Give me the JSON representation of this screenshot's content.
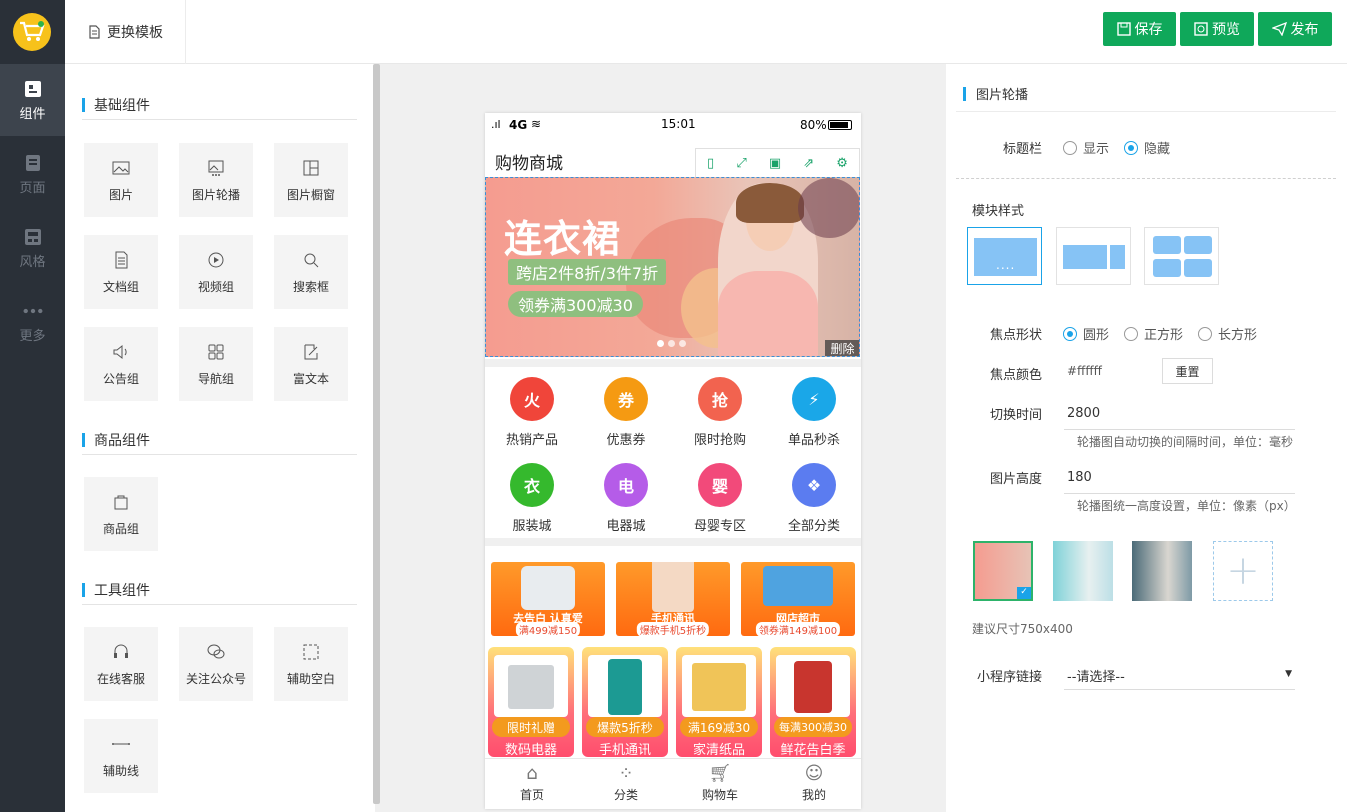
{
  "rail": {
    "items": [
      {
        "label": "组件",
        "icon": "component-icon"
      },
      {
        "label": "页面",
        "icon": "page-icon"
      },
      {
        "label": "风格",
        "icon": "style-icon"
      },
      {
        "label": "更多",
        "icon": "more-icon"
      }
    ]
  },
  "topbar": {
    "template_label": "更换模板",
    "save_label": "保存",
    "preview_label": "预览",
    "publish_label": "发布"
  },
  "left": {
    "sections": [
      {
        "title": "基础组件",
        "tiles": [
          "图片",
          "图片轮播",
          "图片橱窗",
          "文档组",
          "视频组",
          "搜索框",
          "公告组",
          "导航组",
          "富文本"
        ]
      },
      {
        "title": "商品组件",
        "tiles": [
          "商品组"
        ]
      },
      {
        "title": "工具组件",
        "tiles": [
          "在线客服",
          "关注公众号",
          "辅助空白",
          "辅助线"
        ]
      }
    ]
  },
  "phone": {
    "signal": "4G",
    "time": "15:01",
    "battery": "80%",
    "title": "购物商城",
    "banner": {
      "headline": "连衣裙",
      "line1": "跨店2件8折/3件7折",
      "line2": "领券满300减30",
      "delete_label": "删除"
    },
    "nav": [
      {
        "label": "热销产品",
        "color": "#f0453a",
        "glyph": "火"
      },
      {
        "label": "优惠券",
        "color": "#f59a12",
        "glyph": "券"
      },
      {
        "label": "限时抢购",
        "color": "#f2634f",
        "glyph": "抢"
      },
      {
        "label": "单品秒杀",
        "color": "#1aa7e8",
        "glyph": "⚡"
      },
      {
        "label": "服装城",
        "color": "#35b92d",
        "glyph": "衣"
      },
      {
        "label": "电器城",
        "color": "#b55ce8",
        "glyph": "电"
      },
      {
        "label": "母婴专区",
        "color": "#f24a7a",
        "glyph": "婴"
      },
      {
        "label": "全部分类",
        "color": "#5b7cf0",
        "glyph": "❖"
      }
    ],
    "promos": [
      {
        "title": "去告白 认真爱",
        "sub": "满499减150"
      },
      {
        "title": "手机通讯",
        "sub": "爆款手机5折秒"
      },
      {
        "title": "网店超市",
        "sub": "领券满149减100"
      }
    ],
    "products": [
      {
        "tag": "限时礼赠",
        "name": "数码电器"
      },
      {
        "tag": "爆款5折秒",
        "name": "手机通讯"
      },
      {
        "tag": "满169减30",
        "name": "家清纸品"
      },
      {
        "tag": "每满300减30",
        "name": "鲜花告白季"
      }
    ],
    "tabs": [
      "首页",
      "分类",
      "购物车",
      "我的"
    ]
  },
  "right": {
    "panel_title": "图片轮播",
    "titlebar_label": "标题栏",
    "titlebar_options": [
      "显示",
      "隐藏"
    ],
    "module_style_label": "模块样式",
    "focus_shape_label": "焦点形状",
    "focus_shape_options": [
      "圆形",
      "正方形",
      "长方形"
    ],
    "focus_color_label": "焦点颜色",
    "focus_color_value": "#ffffff",
    "reset_label": "重置",
    "switch_time_label": "切换时间",
    "switch_time_value": "2800",
    "switch_time_hint": "轮播图自动切换的间隔时间，单位：毫秒",
    "image_height_label": "图片高度",
    "image_height_value": "180",
    "image_height_hint": "轮播图统一高度设置，单位：像素（px）",
    "size_hint": "建议尺寸750x400",
    "link_label": "小程序链接",
    "link_placeholder": "--请选择--"
  },
  "colors": {
    "accent": "#0fa85a",
    "highlight": "#1aa3e8",
    "rail": "#2a3038"
  }
}
